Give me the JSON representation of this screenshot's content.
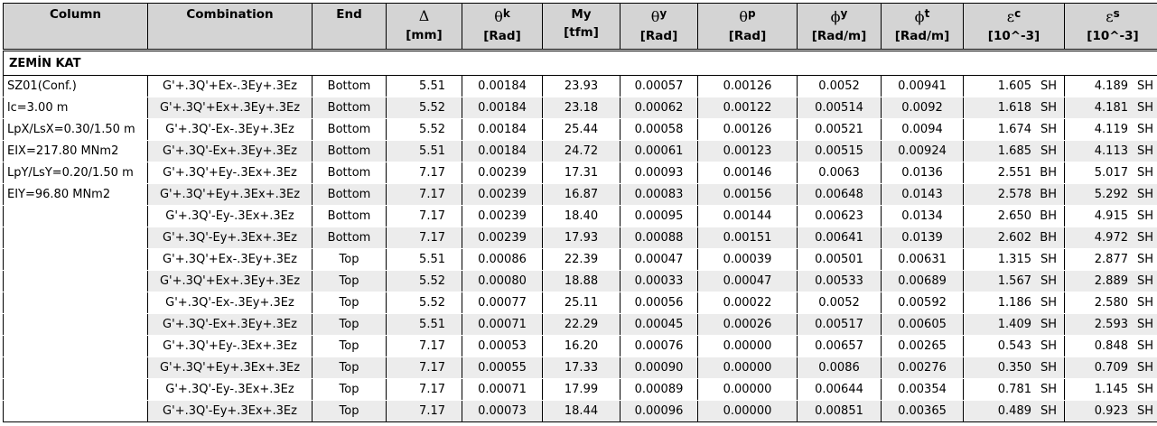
{
  "headers": {
    "column": "Column",
    "combination": "Combination",
    "end": "End",
    "delta": {
      "sym": "Δ",
      "unit": "[mm]"
    },
    "thetak": {
      "sym": "θ",
      "sup": "k",
      "unit": "[Rad]"
    },
    "my": {
      "sym": "My",
      "unit": "[tfm]"
    },
    "thetay": {
      "sym": "θ",
      "sup": "y",
      "unit": "[Rad]"
    },
    "thetap": {
      "sym": "θ",
      "sup": "p",
      "unit": "[Rad]"
    },
    "phiy": {
      "sym": "ϕ",
      "sup": "y",
      "unit": "[Rad/m]"
    },
    "phit": {
      "sym": "ϕ",
      "sup": "t",
      "unit": "[Rad/m]"
    },
    "epsc": {
      "sym": "ε",
      "sup": "c",
      "unit": "[10^-3]"
    },
    "epss": {
      "sym": "ε",
      "sup": "s",
      "unit": "[10^-3]"
    }
  },
  "section": "ZEMİN KAT",
  "rows": [
    {
      "col": "SZ01(Conf.)",
      "comb": "G'+.3Q'+Ex-.3Ey+.3Ez",
      "end": "Bottom",
      "d": "5.51",
      "tk": "0.00184",
      "my": "23.93",
      "ty": "0.00057",
      "tp": "0.00126",
      "py": "0.0052",
      "pt": "0.00941",
      "ec": "1.605",
      "ect": "SH",
      "es": "4.189",
      "est": "SH"
    },
    {
      "col": "lc=3.00 m",
      "comb": "G'+.3Q'+Ex+.3Ey+.3Ez",
      "end": "Bottom",
      "d": "5.52",
      "tk": "0.00184",
      "my": "23.18",
      "ty": "0.00062",
      "tp": "0.00122",
      "py": "0.00514",
      "pt": "0.0092",
      "ec": "1.618",
      "ect": "SH",
      "es": "4.181",
      "est": "SH"
    },
    {
      "col": "LpX/LsX=0.30/1.50 m",
      "comb": "G'+.3Q'-Ex-.3Ey+.3Ez",
      "end": "Bottom",
      "d": "5.52",
      "tk": "0.00184",
      "my": "25.44",
      "ty": "0.00058",
      "tp": "0.00126",
      "py": "0.00521",
      "pt": "0.0094",
      "ec": "1.674",
      "ect": "SH",
      "es": "4.119",
      "est": "SH"
    },
    {
      "col": "EIX=217.80 MNm2",
      "comb": "G'+.3Q'-Ex+.3Ey+.3Ez",
      "end": "Bottom",
      "d": "5.51",
      "tk": "0.00184",
      "my": "24.72",
      "ty": "0.00061",
      "tp": "0.00123",
      "py": "0.00515",
      "pt": "0.00924",
      "ec": "1.685",
      "ect": "SH",
      "es": "4.113",
      "est": "SH"
    },
    {
      "col": "LpY/LsY=0.20/1.50 m",
      "comb": "G'+.3Q'+Ey-.3Ex+.3Ez",
      "end": "Bottom",
      "d": "7.17",
      "tk": "0.00239",
      "my": "17.31",
      "ty": "0.00093",
      "tp": "0.00146",
      "py": "0.0063",
      "pt": "0.0136",
      "ec": "2.551",
      "ect": "BH",
      "es": "5.017",
      "est": "SH"
    },
    {
      "col": "EIY=96.80 MNm2",
      "comb": "G'+.3Q'+Ey+.3Ex+.3Ez",
      "end": "Bottom",
      "d": "7.17",
      "tk": "0.00239",
      "my": "16.87",
      "ty": "0.00083",
      "tp": "0.00156",
      "py": "0.00648",
      "pt": "0.0143",
      "ec": "2.578",
      "ect": "BH",
      "es": "5.292",
      "est": "SH"
    },
    {
      "col": "",
      "comb": "G'+.3Q'-Ey-.3Ex+.3Ez",
      "end": "Bottom",
      "d": "7.17",
      "tk": "0.00239",
      "my": "18.40",
      "ty": "0.00095",
      "tp": "0.00144",
      "py": "0.00623",
      "pt": "0.0134",
      "ec": "2.650",
      "ect": "BH",
      "es": "4.915",
      "est": "SH"
    },
    {
      "col": "",
      "comb": "G'+.3Q'-Ey+.3Ex+.3Ez",
      "end": "Bottom",
      "d": "7.17",
      "tk": "0.00239",
      "my": "17.93",
      "ty": "0.00088",
      "tp": "0.00151",
      "py": "0.00641",
      "pt": "0.0139",
      "ec": "2.602",
      "ect": "BH",
      "es": "4.972",
      "est": "SH"
    },
    {
      "col": "",
      "comb": "G'+.3Q'+Ex-.3Ey+.3Ez",
      "end": "Top",
      "d": "5.51",
      "tk": "0.00086",
      "my": "22.39",
      "ty": "0.00047",
      "tp": "0.00039",
      "py": "0.00501",
      "pt": "0.00631",
      "ec": "1.315",
      "ect": "SH",
      "es": "2.877",
      "est": "SH"
    },
    {
      "col": "",
      "comb": "G'+.3Q'+Ex+.3Ey+.3Ez",
      "end": "Top",
      "d": "5.52",
      "tk": "0.00080",
      "my": "18.88",
      "ty": "0.00033",
      "tp": "0.00047",
      "py": "0.00533",
      "pt": "0.00689",
      "ec": "1.567",
      "ect": "SH",
      "es": "2.889",
      "est": "SH"
    },
    {
      "col": "",
      "comb": "G'+.3Q'-Ex-.3Ey+.3Ez",
      "end": "Top",
      "d": "5.52",
      "tk": "0.00077",
      "my": "25.11",
      "ty": "0.00056",
      "tp": "0.00022",
      "py": "0.0052",
      "pt": "0.00592",
      "ec": "1.186",
      "ect": "SH",
      "es": "2.580",
      "est": "SH"
    },
    {
      "col": "",
      "comb": "G'+.3Q'-Ex+.3Ey+.3Ez",
      "end": "Top",
      "d": "5.51",
      "tk": "0.00071",
      "my": "22.29",
      "ty": "0.00045",
      "tp": "0.00026",
      "py": "0.00517",
      "pt": "0.00605",
      "ec": "1.409",
      "ect": "SH",
      "es": "2.593",
      "est": "SH"
    },
    {
      "col": "",
      "comb": "G'+.3Q'+Ey-.3Ex+.3Ez",
      "end": "Top",
      "d": "7.17",
      "tk": "0.00053",
      "my": "16.20",
      "ty": "0.00076",
      "tp": "0.00000",
      "py": "0.00657",
      "pt": "0.00265",
      "ec": "0.543",
      "ect": "SH",
      "es": "0.848",
      "est": "SH"
    },
    {
      "col": "",
      "comb": "G'+.3Q'+Ey+.3Ex+.3Ez",
      "end": "Top",
      "d": "7.17",
      "tk": "0.00055",
      "my": "17.33",
      "ty": "0.00090",
      "tp": "0.00000",
      "py": "0.0086",
      "pt": "0.00276",
      "ec": "0.350",
      "ect": "SH",
      "es": "0.709",
      "est": "SH"
    },
    {
      "col": "",
      "comb": "G'+.3Q'-Ey-.3Ex+.3Ez",
      "end": "Top",
      "d": "7.17",
      "tk": "0.00071",
      "my": "17.99",
      "ty": "0.00089",
      "tp": "0.00000",
      "py": "0.00644",
      "pt": "0.00354",
      "ec": "0.781",
      "ect": "SH",
      "es": "1.145",
      "est": "SH"
    },
    {
      "col": "",
      "comb": "G'+.3Q'-Ey+.3Ex+.3Ez",
      "end": "Top",
      "d": "7.17",
      "tk": "0.00073",
      "my": "18.44",
      "ty": "0.00096",
      "tp": "0.00000",
      "py": "0.00851",
      "pt": "0.00365",
      "ec": "0.489",
      "ect": "SH",
      "es": "0.923",
      "est": "SH"
    }
  ]
}
